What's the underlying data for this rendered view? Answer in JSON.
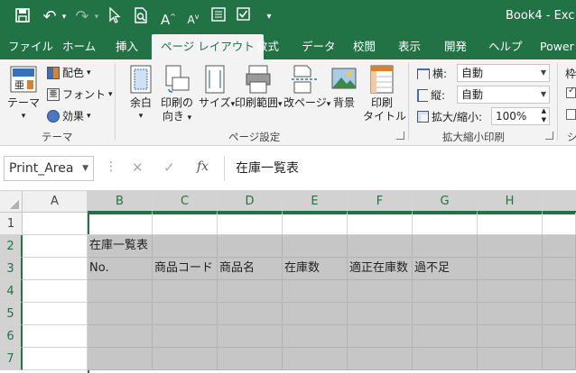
{
  "window": {
    "title": "Book4  -  Exc",
    "quick_access": {
      "undo_glyph": "↶",
      "redo_glyph": "↷",
      "font_up": "A",
      "font_down": "A",
      "more": "▾"
    }
  },
  "tabs": [
    {
      "label": "ファイル"
    },
    {
      "label": "ホーム"
    },
    {
      "label": "挿入"
    },
    {
      "label": "ページ レイアウト",
      "active": true
    },
    {
      "label": "数式"
    },
    {
      "label": "データ"
    },
    {
      "label": "校閲"
    },
    {
      "label": "表示"
    },
    {
      "label": "開発"
    },
    {
      "label": "ヘルプ"
    },
    {
      "label": "Power"
    }
  ],
  "ribbon": {
    "theme_group": {
      "themes_label": "テーマ",
      "colors_label": "配色",
      "fonts_label": "フォント",
      "effects_label": "効果",
      "group_label": "テーマ"
    },
    "page_setup": {
      "margins": "余白",
      "orientation_1": "印刷の",
      "orientation_2": "向き",
      "size": "サイズ",
      "print_area": "印刷範囲",
      "breaks": "改ページ",
      "background": "背景",
      "print_titles_1": "印刷",
      "print_titles_2": "タイトル",
      "group_label": "ページ設定"
    },
    "scale_to_fit": {
      "width_label": "横:",
      "width_value": "自動",
      "height_label": "縦:",
      "height_value": "自動",
      "scale_label": "拡大/縮小:",
      "scale_value": "100%",
      "group_label": "拡大縮小印刷"
    },
    "sheet_options": {
      "label_partial": "枠",
      "group_partial": "シ"
    }
  },
  "formula_bar": {
    "name_box": "Print_Area",
    "cancel": "✕",
    "enter": "✓",
    "fx": "fx",
    "content": "在庫一覧表"
  },
  "grid": {
    "columns": [
      "A",
      "B",
      "C",
      "D",
      "E",
      "F",
      "G",
      "H"
    ],
    "rows": [
      "1",
      "2",
      "3",
      "4",
      "5",
      "6",
      "7"
    ],
    "cells": {
      "B2": "在庫一覧表",
      "B3": "No.",
      "C3": "商品コード",
      "D3": "商品名",
      "E3": "在庫数",
      "F3": "適正在庫数",
      "G3": "過不足"
    }
  },
  "colors": {
    "accent": "#217346",
    "selection_fill": "#c6c6c6"
  }
}
